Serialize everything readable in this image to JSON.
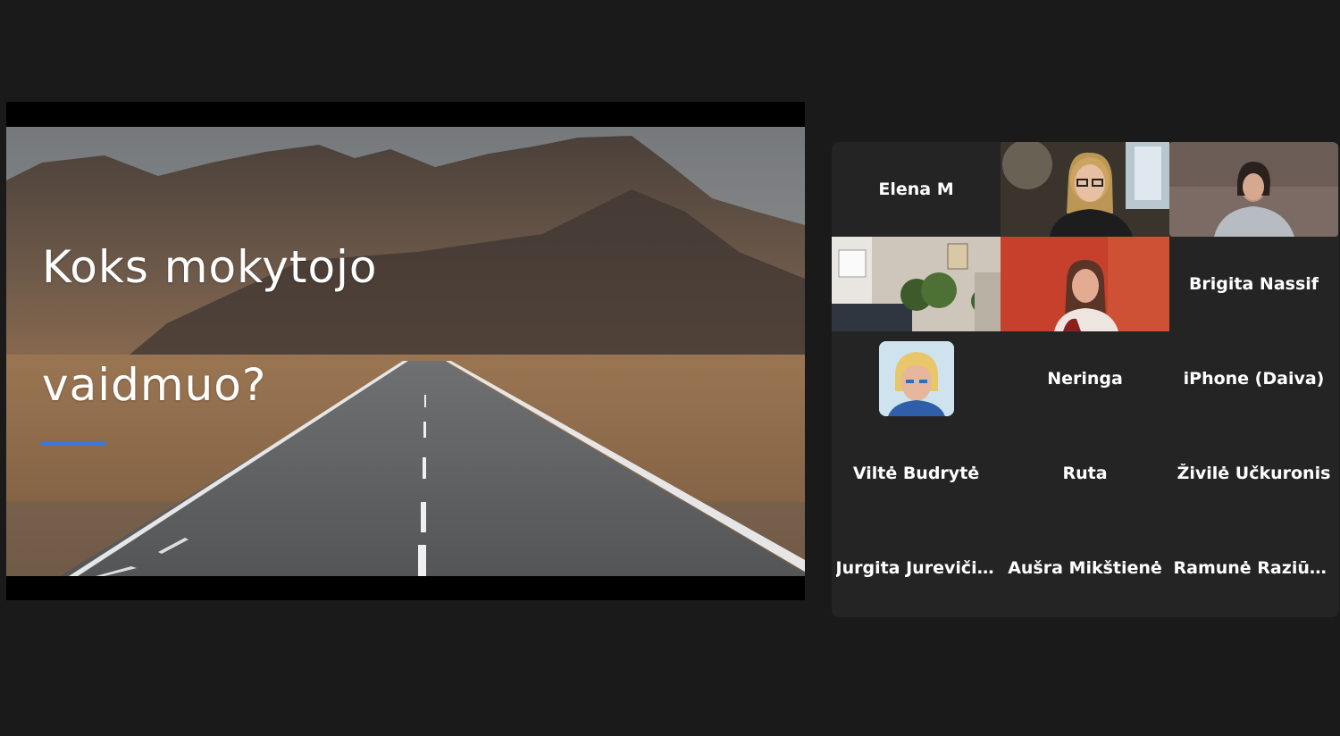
{
  "slide": {
    "title_line1": "Koks mokytojo",
    "title_line2": "vaidmuo?",
    "accent_color": "#3c78d8"
  },
  "gallery": {
    "active_border_color": "#2ed48a",
    "participants": [
      {
        "name": "Elena M",
        "type": "name"
      },
      {
        "name": "",
        "type": "video",
        "video": "woman-with-glasses"
      },
      {
        "name": "",
        "type": "video",
        "video": "speaker-active"
      },
      {
        "name": "",
        "type": "video",
        "video": "room-with-plants"
      },
      {
        "name": "",
        "type": "video",
        "video": "woman-red-background"
      },
      {
        "name": "Brigita Nassif",
        "type": "name"
      },
      {
        "name": "",
        "type": "avatar",
        "video": "profile-photo"
      },
      {
        "name": "Neringa",
        "type": "name"
      },
      {
        "name": "iPhone (Daiva)",
        "type": "name"
      },
      {
        "name": "Viltė Budrytė",
        "type": "name"
      },
      {
        "name": "Ruta",
        "type": "name"
      },
      {
        "name": "Živilė Učkuronis",
        "type": "name"
      },
      {
        "name": "Jurgita  Jurevičiūtė",
        "type": "name"
      },
      {
        "name": "Aušra  Mikštienė",
        "type": "name"
      },
      {
        "name": "Ramunė  Raziūnienė",
        "type": "name"
      }
    ]
  }
}
